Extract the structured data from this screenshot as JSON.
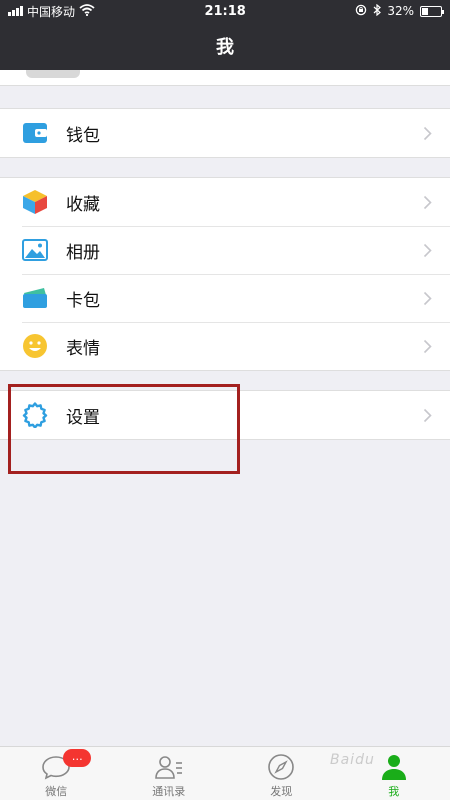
{
  "status_bar": {
    "carrier": "中国移动",
    "time": "21:18",
    "battery_percent": "32%",
    "battery_level": 0.32,
    "icons": [
      "signal-icon",
      "wifi-icon",
      "rotation-lock-icon",
      "bluetooth-icon",
      "battery-icon"
    ]
  },
  "nav": {
    "title": "我"
  },
  "groups": {
    "wallet": {
      "label": "钱包"
    },
    "favorites": {
      "label": "收藏"
    },
    "album": {
      "label": "相册"
    },
    "cards": {
      "label": "卡包"
    },
    "stickers": {
      "label": "表情"
    },
    "settings": {
      "label": "设置"
    }
  },
  "tabs": [
    {
      "label": "微信",
      "badge": "…",
      "icon": "chat-icon"
    },
    {
      "label": "通讯录",
      "icon": "contacts-icon"
    },
    {
      "label": "发现",
      "icon": "compass-icon"
    },
    {
      "label": "我",
      "icon": "me-icon",
      "active": true
    }
  ],
  "watermark": "Baidu",
  "colors": {
    "nav_bg": "#2e2e33",
    "page_bg": "#efeff4",
    "active_tab": "#1aad19",
    "badge": "#f43530",
    "highlight": "#a3201f",
    "settings_icon": "#2f9fe0"
  }
}
